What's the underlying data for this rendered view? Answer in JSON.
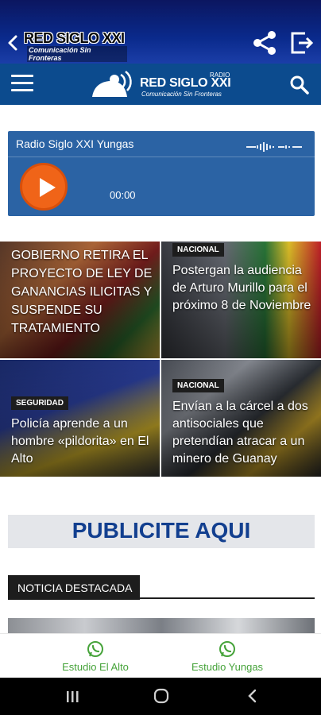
{
  "appbar": {
    "brand_title": "RED SIGLO XXI",
    "brand_subtitle": "Comunicación Sin Fronteras"
  },
  "navbar": {
    "logo_small": "RADIO",
    "logo_title": "RED SIGLO XXI",
    "logo_subtitle": "Comunicación Sin Fronteras"
  },
  "player": {
    "station": "Radio Siglo XXI Yungas",
    "time": "00:00"
  },
  "news": [
    {
      "tag": "",
      "headline": "GOBIERNO RETIRA EL PROYECTO DE LEY DE GANANCIAS ILICITAS Y SUSPENDE SU TRATAMIENTO"
    },
    {
      "tag": "NACIONAL",
      "headline": "Postergan la audiencia de Arturo Murillo para el próximo 8 de Noviembre"
    },
    {
      "tag": "SEGURIDAD",
      "headline": "Policía aprende a un hombre «pildorita» en El Alto"
    },
    {
      "tag": "NACIONAL",
      "headline": "Envían a la cárcel a dos antisociales que pretendían atracar a un minero de Guanay"
    }
  ],
  "ad": {
    "text": "PUBLICITE AQUI"
  },
  "section": {
    "title": "NOTICIA DESTACADA"
  },
  "studios": [
    {
      "label": "Estudio El Alto"
    },
    {
      "label": "Estudio Yungas"
    }
  ],
  "colors": {
    "appbar": "#0a2a8c",
    "navbar": "#0c4b8e",
    "player": "#2b63a4",
    "play": "#f06418",
    "whatsapp": "#46a33a"
  }
}
